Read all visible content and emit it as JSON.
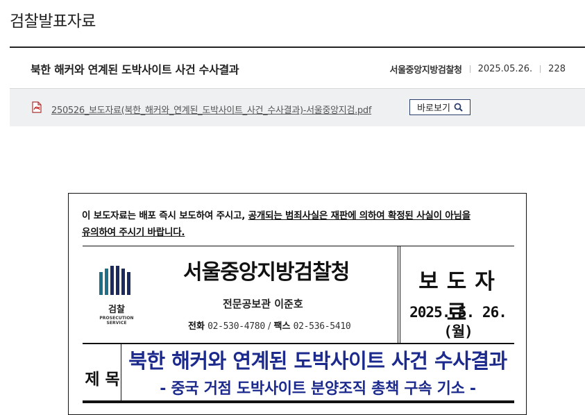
{
  "page": {
    "title": "검찰발표자료"
  },
  "article": {
    "title": "북한 해커와 연계된 도박사이트 사건 수사결과",
    "organization": "서울중앙지방검찰청",
    "date": "2025.05.26.",
    "views": "228"
  },
  "attachment": {
    "file_name": "250526_보도자료(북한_해커와_연계된_도박사이트_사건_수사결과)-서울중앙지검.pdf",
    "view_button_label": "바로보기",
    "file_icon": "pdf-file-icon",
    "button_icon": "search-icon"
  },
  "document": {
    "notice_line1_a": "이 보도자료는 배포 즉시 보도하여 주시고, ",
    "notice_line1_b": "공개되는 범죄사실은 재판에 의하여 확정된 사실이 아님을",
    "notice_line2": "유의하여 주시기 바랍니다.",
    "logo_name": "검찰",
    "logo_sub": "PROSECUTION SERVICE",
    "office_name": "서울중앙지방검찰청",
    "spokesperson": "전문공보관 이준호",
    "phone_label": "전화",
    "phone": "02-530-4780",
    "slash": "/",
    "fax_label": "팩스",
    "fax": "02-536-5410",
    "press_label": "보도자료",
    "press_date": "2025. 5. 26.(월)",
    "subject_label": "제 목",
    "subject_title": "북한 해커와 연계된 도박사이트 사건 수사결과",
    "subject_subtitle": "- 중국 거점 도박사이트 분양조직 총책 구속 기소 -"
  },
  "colors": {
    "accent": "#1b2a8c",
    "logo_teal": "#1f6f86",
    "logo_navy": "#1c2a5e"
  }
}
